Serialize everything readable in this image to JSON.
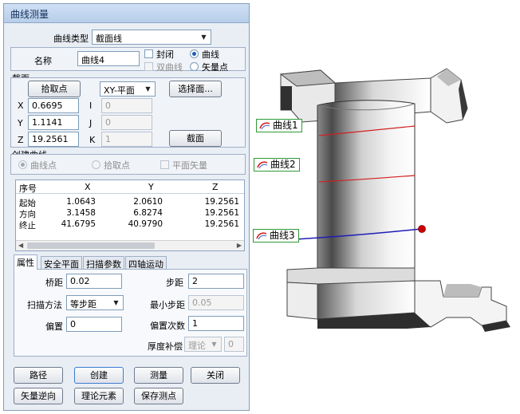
{
  "dialog": {
    "title": "曲线测量",
    "curve_type_label": "曲线类型",
    "curve_type_value": "截面线",
    "name_label": "名称",
    "name_value": "曲线4",
    "closed_label": "封闭",
    "double_curve_label": "双曲线",
    "radio_curve_label": "曲线",
    "radio_vector_label": "矢量点",
    "section": {
      "group_label": "截面",
      "pick_button": "拾取点",
      "plane_value": "XY-平面",
      "select_face_button": "选择面...",
      "x_label": "X",
      "x_value": "0.6695",
      "y_label": "Y",
      "y_value": "1.1141",
      "z_label": "Z",
      "z_value": "19.2561",
      "i_label": "I",
      "i_value": "0",
      "j_label": "J",
      "j_value": "0",
      "k_label": "K",
      "k_value": "1",
      "section_button": "截面"
    },
    "create": {
      "group_label": "创建曲线",
      "curve_point_label": "曲线点",
      "pick_point_label": "拾取点",
      "plane_vector_label": "平面矢量"
    },
    "table": {
      "headers": [
        "序号",
        "X",
        "Y",
        "Z"
      ],
      "rows": [
        [
          "起始",
          "1.0643",
          "2.0610",
          "19.2561"
        ],
        [
          "方向",
          "3.1458",
          "6.8274",
          "19.2561"
        ],
        [
          "终止",
          "41.6795",
          "40.9790",
          "19.2561"
        ]
      ]
    },
    "tabs": [
      "属性",
      "安全平面",
      "扫描参数",
      "四轴运动"
    ],
    "props": {
      "bridge_label": "桥距",
      "bridge_value": "0.02",
      "step_label": "步距",
      "step_value": "2",
      "scan_method_label": "扫描方法",
      "scan_method_value": "等步距",
      "min_step_label": "最小步距",
      "min_step_value": "0.05",
      "offset_label": "偏置",
      "offset_value": "0",
      "offset_count_label": "偏置次数",
      "offset_count_value": "1",
      "thickness_label": "厚度补偿",
      "thickness_value": "理论",
      "thickness_num": "0"
    },
    "buttons": {
      "path": "路径",
      "create": "创建",
      "measure": "测量",
      "close": "关闭",
      "reverse": "矢量逆向",
      "theory": "理论元素",
      "save": "保存测点"
    }
  },
  "view3d": {
    "callouts": [
      "曲线1",
      "曲线2",
      "曲线3"
    ],
    "colors": {
      "curve_red": "#d42020",
      "curve_blue": "#1d1db8",
      "callout_border": "#2f9a3a",
      "probe": "#cc0000"
    }
  }
}
